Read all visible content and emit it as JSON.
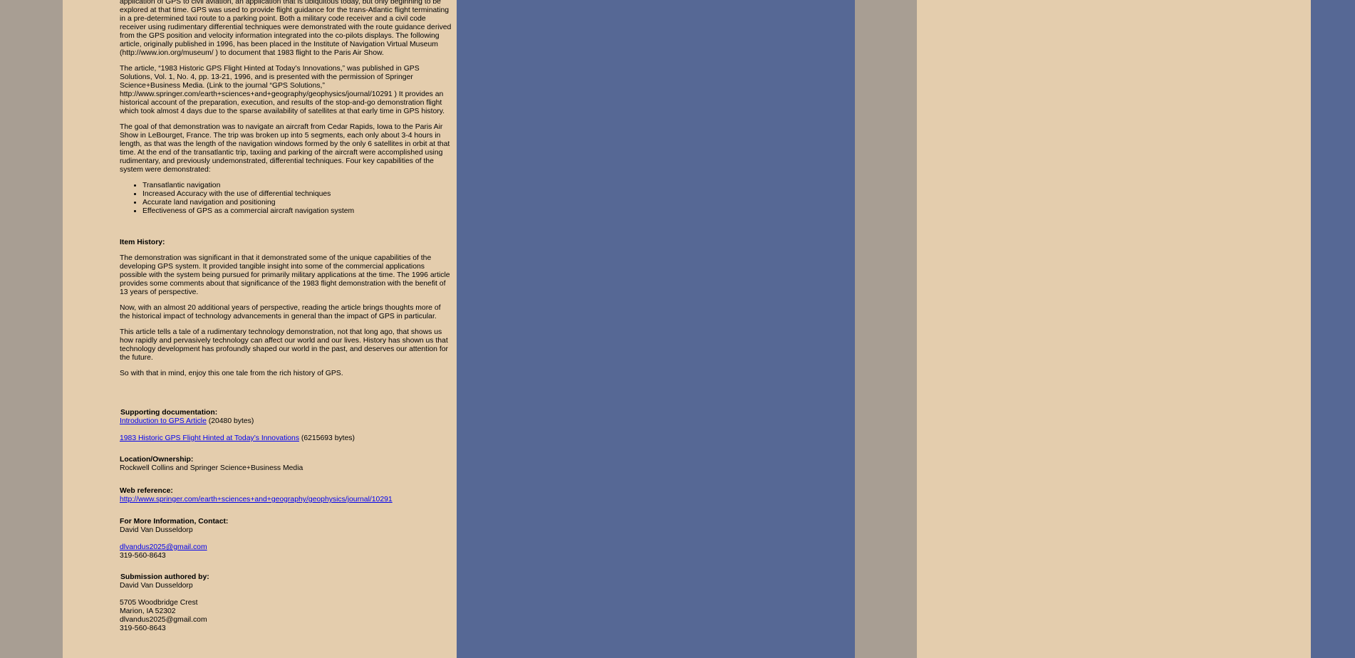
{
  "colors": {
    "left_margin": "#a89e93",
    "content_panel": "#e4cdad",
    "accent_panel": "#566895",
    "link": "#0000ee"
  },
  "intro_paragraph": "application of GPS to civil aviation, an application that is ubiquitous today, but only beginning to be explored at that time. GPS was used to provide flight guidance for the trans-Atlantic flight terminating in a pre-determined taxi route to a parking point. Both a military code receiver and a civil code receiver using rudimentary differential techniques were demonstrated with the route guidance derived from the GPS position and velocity information integrated into the co-pilots displays. The following article, originally published in 1996, has been placed in the Institute of Navigation Virtual Museum (http://www.ion.org/museum/ ) to document that 1983 flight to the Paris Air Show.",
  "article_paragraph": "The article, “1983 Historic GPS Flight Hinted at Today’s Innovations,” was published in GPS Solutions, Vol. 1, No. 4, pp. 13-21, 1996, and is presented with the permission of Springer Science+Business Media. (Link to the journal “GPS Solutions,” http://www.springer.com/earth+sciences+and+geography/geophysics/journal/10291 ) It provides an historical account of the preparation, execution, and results of the stop-and-go demonstration flight which took almost 4 days due to the sparse availability of satellites at that early time in GPS history.",
  "goal_paragraph": "The goal of that demonstration was to navigate an aircraft from Cedar Rapids, Iowa to the Paris Air Show in LeBourget, France. The trip was broken up into 5 segments, each only about 3-4 hours in length, as that was the length of the navigation windows formed by the only 6 satellites in orbit at that time. At the end of the transatlantic trip, taxiing and parking of the aircraft were accomplished using rudimentary, and previously undemonstrated, differential techniques. Four key capabilities of the system were demonstrated:",
  "capabilities": [
    "Transatlantic navigation",
    "Increased Accuracy with the use of differential techniques",
    "Accurate land navigation and positioning",
    "Effectiveness of GPS as a commercial aircraft navigation system"
  ],
  "item_history": {
    "heading": "Item History:",
    "paragraphs": [
      "The demonstration was significant in that it demonstrated some of the unique capabilities of the developing GPS system. It provided tangible insight into some of the commercial applications possible with the system being pursued for primarily military applications at the time. The 1996 article provides some comments about that significance of the 1983 flight demonstration with the benefit of 13 years of perspective.",
      "Now, with an almost 20 additional years of perspective, reading the article brings thoughts more of the historical impact of technology advancements in general than the impact of GPS in particular.",
      "This article tells a tale of a rudimentary technology demonstration, not that long ago, that shows us how rapidly and pervasively technology can affect our world and our lives. History has shown us that technology development has profoundly shaped our world in the past, and deserves our attention for the future.",
      "So with that in mind, enjoy this one tale from the rich history of GPS."
    ]
  },
  "supporting_documentation": {
    "heading": "Supporting documentation:",
    "files": [
      {
        "label": "Introduction to GPS Article",
        "size": "(20480 bytes)"
      },
      {
        "label": "1983 Historic GPS Flight Hinted at Today’s Innovations",
        "size": "(6215693 bytes)"
      }
    ]
  },
  "location_ownership": {
    "heading": "Location/Ownership:",
    "value": "Rockwell Collins and Springer Science+Business Media"
  },
  "web_reference": {
    "heading": "Web reference:",
    "url": "http://www.springer.com/earth+sciences+and+geography/geophysics/journal/10291"
  },
  "contact": {
    "heading": "For More Information, Contact:",
    "name": "David Van Dusseldorp",
    "email": "dlvandus2025@gmail.com",
    "phone": "319-560-8643"
  },
  "submission": {
    "heading": "Submission authored by:",
    "name": "David Van Dusseldorp",
    "address_line1": "5705 Woodbridge Crest",
    "address_line2": "Marion, IA 52302",
    "email": "dlvandus2025@gmail.com",
    "phone": "319-560-8643"
  }
}
